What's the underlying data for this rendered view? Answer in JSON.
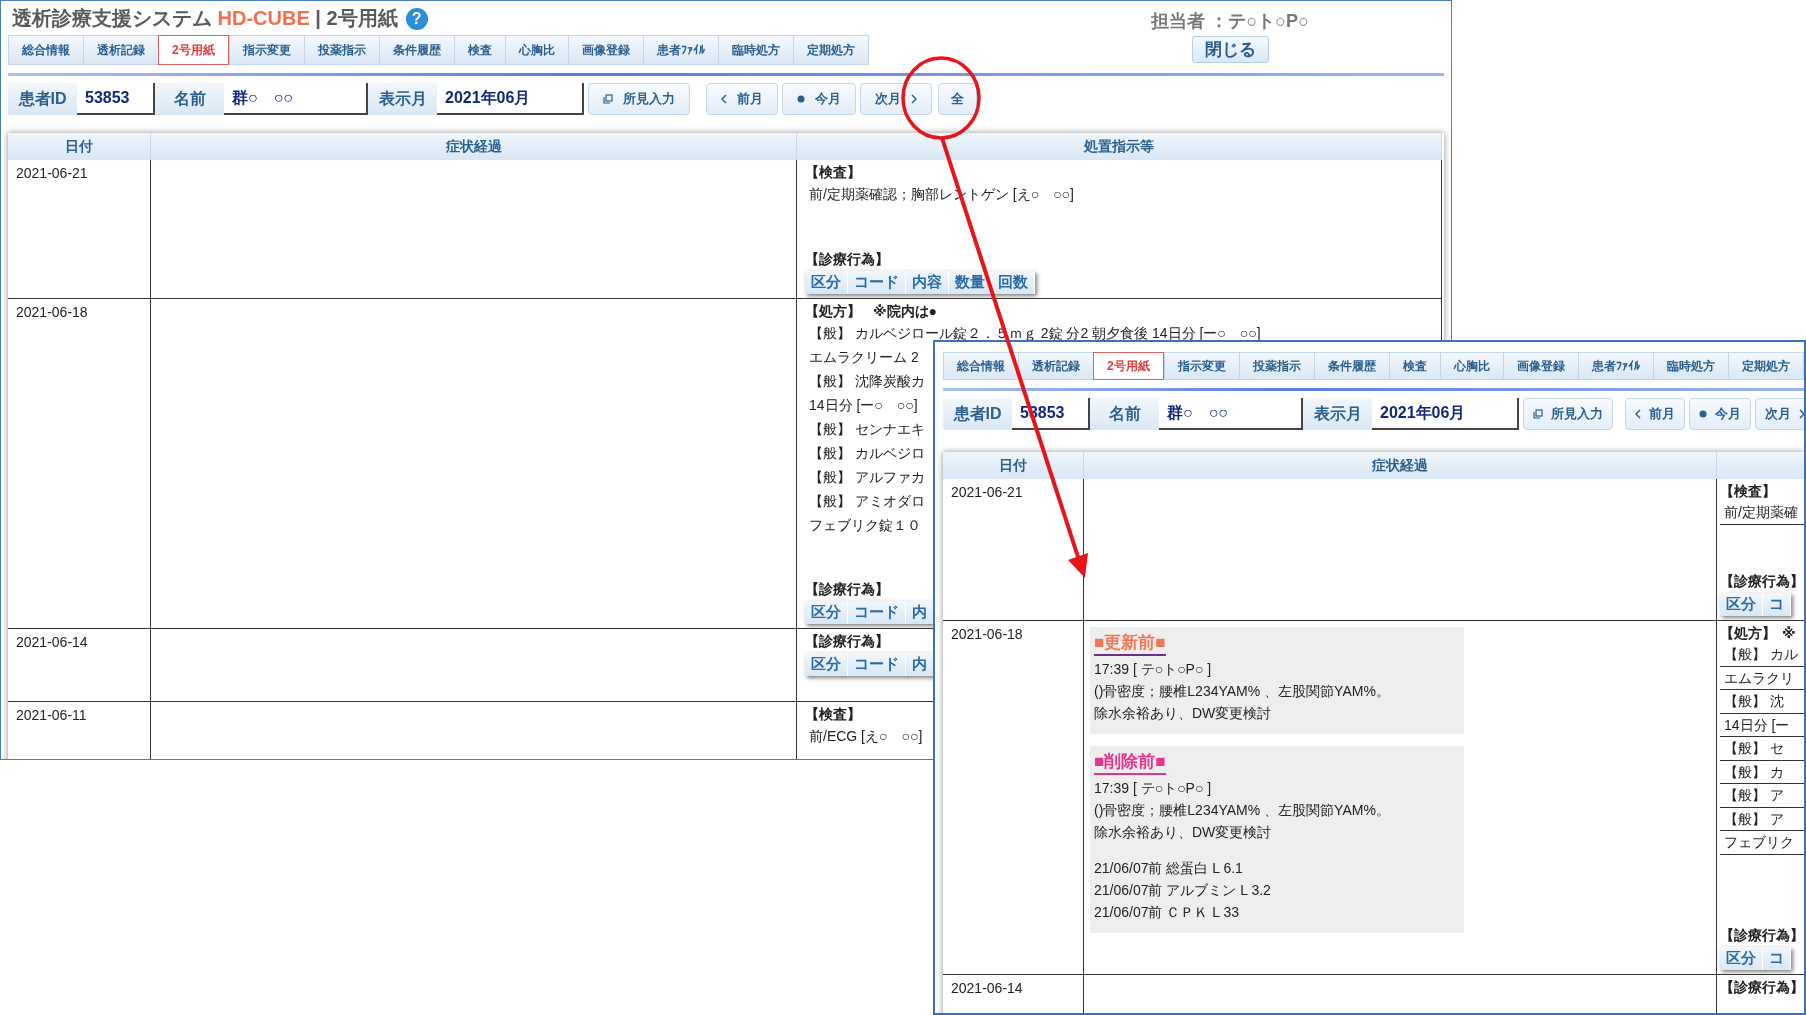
{
  "windows": [
    {
      "title": {
        "app": "透析診療支援システム",
        "product": "HD-CUBE",
        "page": "| 2号用紙",
        "help": "?"
      },
      "staff": "担当者 ：テ○ト○P○",
      "close_button": "閉じる",
      "tabs": [
        {
          "label": "総合情報",
          "selected": false
        },
        {
          "label": "透析記録",
          "selected": false
        },
        {
          "label": "2号用紙",
          "selected": true
        },
        {
          "label": "指示変更",
          "selected": false
        },
        {
          "label": "投薬指示",
          "selected": false
        },
        {
          "label": "条件履歴",
          "selected": false
        },
        {
          "label": "検査",
          "selected": false
        },
        {
          "label": "心胸比",
          "selected": false
        },
        {
          "label": "画像登録",
          "selected": false
        },
        {
          "label": "患者ﾌｧｲﾙ",
          "selected": false
        },
        {
          "label": "臨時処方",
          "selected": false
        },
        {
          "label": "定期処方",
          "selected": false
        }
      ],
      "toolbar": {
        "fields": [
          {
            "label": "患者ID",
            "value": "53853"
          },
          {
            "label": "名前",
            "value": "群○　○○"
          },
          {
            "label": "表示月",
            "value": "2021年06月"
          }
        ],
        "buttons": [
          {
            "kind": "findings",
            "label": "所見入力"
          },
          {
            "kind": "prev",
            "label": "前月"
          },
          {
            "kind": "today",
            "label": "今月"
          },
          {
            "kind": "next",
            "label": "次月"
          },
          {
            "kind": "all",
            "label": "全"
          }
        ]
      },
      "table": {
        "columns": [
          "日付",
          "症状経過",
          "処置指示等"
        ],
        "rows": [
          {
            "date": "2021-06-21",
            "treatment": [
              {
                "heading": "【検査】",
                "lines": [
                  "前/定期薬確認；胸部レントゲン [え○　○○]"
                ],
                "ruled": false
              },
              {
                "heading": "【診療行為】",
                "subtable": [
                  "区分",
                  "コード",
                  "内容",
                  "数量",
                  "回数"
                ]
              }
            ]
          },
          {
            "date": "2021-06-18",
            "treatment": [
              {
                "heading": "【処方】",
                "note": "※院内は●",
                "lines": [
                  "【般】 カルベジロール錠２．５ｍｇ 2錠 分2 朝夕食後 14日分 [ー○　○○]",
                  "エムラクリーム 2",
                  "【般】 沈降炭酸カ",
                  "14日分 [ー○　○○]",
                  "【般】 センナエキ",
                  "【般】 カルベジロ",
                  "【般】 アルファカ",
                  "【般】 アミオダロ",
                  "フェブリク錠１０"
                ],
                "ruled": false
              },
              {
                "heading": "【診療行為】",
                "subtable": [
                  "区分",
                  "コード",
                  "内"
                ]
              }
            ]
          },
          {
            "date": "2021-06-14",
            "treatment": [
              {
                "heading": "【診療行為】",
                "subtable": [
                  "区分",
                  "コード",
                  "内"
                ]
              }
            ]
          },
          {
            "date": "2021-06-11",
            "treatment": [
              {
                "heading": "【検査】",
                "lines": [
                  "前/ECG [え○　○○]"
                ],
                "ruled": false
              }
            ]
          }
        ]
      }
    },
    {
      "tabs": [
        {
          "label": "総合情報",
          "selected": false
        },
        {
          "label": "透析記録",
          "selected": false
        },
        {
          "label": "2号用紙",
          "selected": true
        },
        {
          "label": "指示変更",
          "selected": false
        },
        {
          "label": "投薬指示",
          "selected": false
        },
        {
          "label": "条件履歴",
          "selected": false
        },
        {
          "label": "検査",
          "selected": false
        },
        {
          "label": "心胸比",
          "selected": false
        },
        {
          "label": "画像登録",
          "selected": false
        },
        {
          "label": "患者ﾌｧｲﾙ",
          "selected": false
        },
        {
          "label": "臨時処方",
          "selected": false
        },
        {
          "label": "定期処方",
          "selected": false
        }
      ],
      "toolbar": {
        "fields": [
          {
            "label": "患者ID",
            "value": "53853"
          },
          {
            "label": "名前",
            "value": "群○　○○"
          },
          {
            "label": "表示月",
            "value": "2021年06月"
          }
        ],
        "buttons": [
          {
            "kind": "findings",
            "label": "所見入力"
          },
          {
            "kind": "prev",
            "label": "前月"
          },
          {
            "kind": "today",
            "label": "今月"
          },
          {
            "kind": "next",
            "label": "次月"
          }
        ]
      },
      "table": {
        "columns": [
          "日付",
          "症状経過"
        ],
        "rows": [
          {
            "date": "2021-06-21",
            "treatment": [
              {
                "heading": "【検査】",
                "lines": [
                  "前/定期薬確"
                ],
                "ruled": true
              },
              {
                "heading": "【診療行為】",
                "subtable": [
                  "区分",
                  "コ"
                ]
              }
            ]
          },
          {
            "date": "2021-06-18",
            "history": [
              {
                "kind": "before_update",
                "heading": "■更新前■",
                "lines": [
                  "17:39 [ テ○ト○P○ ]",
                  "()骨密度；腰椎L234YAM% 、左股関節YAM%。",
                  "除水余裕あり、DW変更検討"
                ]
              },
              {
                "kind": "before_delete",
                "heading": "■削除前■",
                "lines": [
                  "17:39 [ テ○ト○P○ ]",
                  "()骨密度；腰椎L234YAM% 、左股関節YAM%。",
                  "除水余裕あり、DW変更検討"
                ],
                "lab_results": [
                  "21/06/07前 総蛋白 L 6.1",
                  "21/06/07前 アルブミン L 3.2",
                  "21/06/07前 ＣＰＫ L 33"
                ]
              }
            ],
            "treatment": [
              {
                "heading": "【処方】",
                "note": "※",
                "lines": [
                  "【般】 カル",
                  "エムラクリ",
                  "【般】 沈",
                  "14日分 [ー",
                  "【般】 セ",
                  "【般】 カ",
                  "【般】 ア",
                  "【般】 ア",
                  "フェブリク"
                ],
                "ruled": true
              },
              {
                "heading": "【診療行為】",
                "subtable": [
                  "区分",
                  "コ"
                ]
              }
            ]
          },
          {
            "date": "2021-06-14",
            "treatment": [
              {
                "heading": "【診療行為】"
              }
            ]
          }
        ]
      }
    }
  ]
}
